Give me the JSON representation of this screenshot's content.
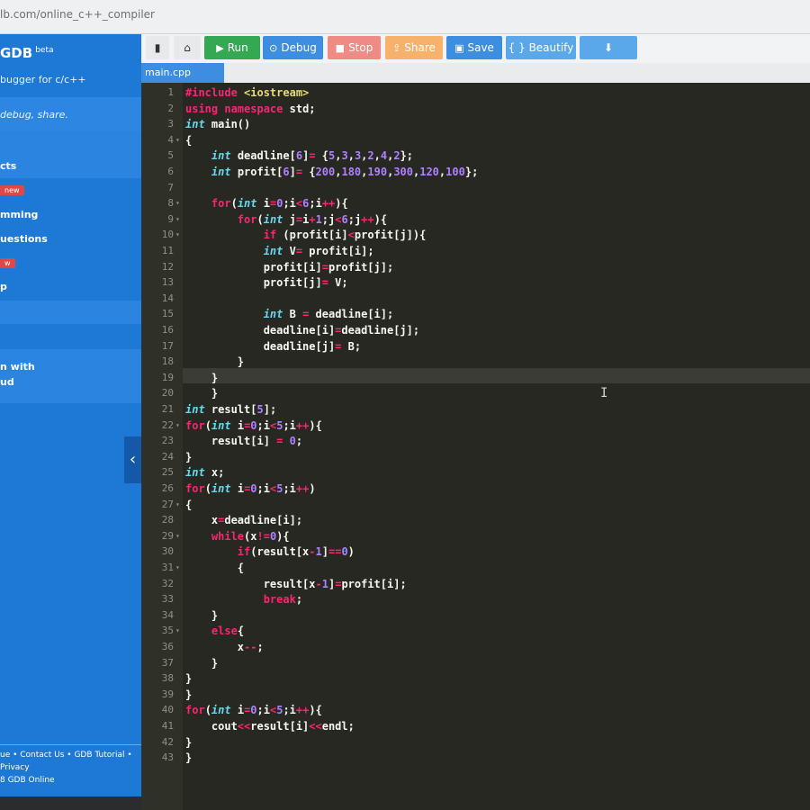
{
  "url": "lb.com/online_c++_compiler",
  "sidebar": {
    "brand": "GDB",
    "brand_tag": "beta",
    "tagline": "bugger for c/c++",
    "desc": "debug, share.",
    "items": [
      "cts",
      "mming",
      "uestions",
      "p",
      "n with",
      "ud"
    ],
    "badge_new": "new",
    "badge2": "w",
    "collapse": "‹",
    "footer": [
      "ue • Contact Us • GDB Tutorial •",
      "Privacy",
      "8 GDB Online"
    ]
  },
  "toolbar": {
    "run": "Run",
    "debug": "Debug",
    "stop": "Stop",
    "share": "Share",
    "save": "Save",
    "beautify": "{ } Beautify",
    "download": "⬇",
    "file_icon": "file-icon",
    "upload_icon": "upload-icon"
  },
  "tab": {
    "filename": "main.cpp"
  },
  "editor": {
    "folds": [
      "4",
      "8",
      "9",
      "10",
      "22",
      "27",
      "29",
      "31",
      "35"
    ],
    "cursor": "I",
    "lines": [
      "#include <iostream>",
      "using namespace std;",
      "int main()",
      "{",
      "    int deadline[6]= {5,3,3,2,4,2};",
      "    int profit[6]= {200,180,190,300,120,100};",
      "",
      "    for(int i=0;i<6;i++){",
      "        for(int j=i+1;j<6;j++){",
      "            if (profit[i]<profit[j]){",
      "            int V= profit[i];",
      "            profit[i]=profit[j];",
      "            profit[j]= V;",
      "",
      "            int B = deadline[i];",
      "            deadline[i]=deadline[j];",
      "            deadline[j]= B;",
      "        }",
      "    }",
      "    }",
      "int result[5];",
      "for(int i=0;i<5;i++){",
      "    result[i] = 0;",
      "}",
      "int x;",
      "for(int i=0;i<5;i++)",
      "{",
      "    x=deadline[i];",
      "    while(x!=0){",
      "        if(result[x-1]==0)",
      "        {",
      "            result[x-1]=profit[i];",
      "            break;",
      "    }",
      "    else{",
      "        x--;",
      "    }",
      "}",
      "}",
      "for(int i=0;i<5;i++){",
      "    cout<<result[i]<<endl;",
      "}",
      "}"
    ]
  }
}
